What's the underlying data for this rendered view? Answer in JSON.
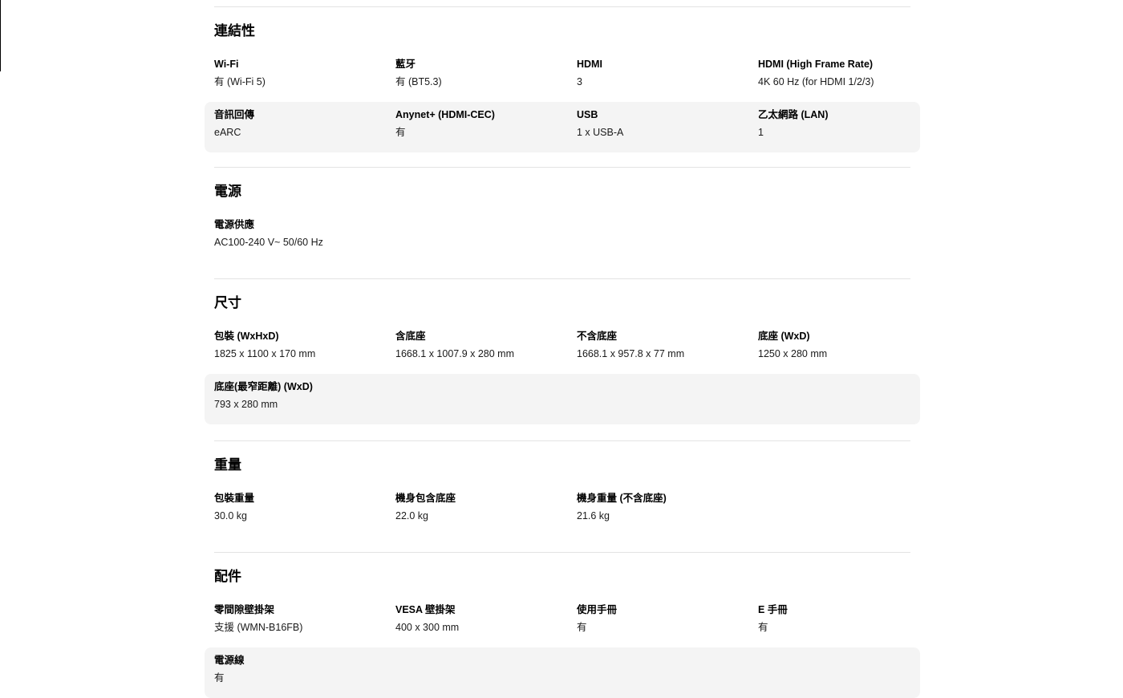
{
  "sections": [
    {
      "title": "連結性",
      "rows": [
        [
          {
            "label": "Wi-Fi",
            "value": "有 (Wi-Fi 5)"
          },
          {
            "label": "藍牙",
            "value": "有 (BT5.3)"
          },
          {
            "label": "HDMI",
            "value": "3"
          },
          {
            "label": "HDMI (High Frame Rate)",
            "value": "4K 60 Hz (for HDMI 1/2/3)"
          }
        ],
        [
          {
            "label": "音訊回傳",
            "value": "eARC"
          },
          {
            "label": "Anynet+ (HDMI-CEC)",
            "value": "有"
          },
          {
            "label": "USB",
            "value": "1 x USB-A"
          },
          {
            "label": "乙太網路 (LAN)",
            "value": "1"
          }
        ]
      ]
    },
    {
      "title": "電源",
      "rows": [
        [
          {
            "label": "電源供應",
            "value": "AC100-240 V~ 50/60 Hz"
          }
        ]
      ]
    },
    {
      "title": "尺寸",
      "rows": [
        [
          {
            "label": "包裝 (WxHxD)",
            "value": "1825 x 1100 x 170 mm"
          },
          {
            "label": "含底座",
            "value": "1668.1 x 1007.9 x 280 mm"
          },
          {
            "label": "不含底座",
            "value": "1668.1 x 957.8 x 77 mm"
          },
          {
            "label": "底座 (WxD)",
            "value": "1250 x 280 mm"
          }
        ],
        [
          {
            "label": "底座(最窄距離) (WxD)",
            "value": "793 x 280 mm"
          }
        ]
      ]
    },
    {
      "title": "重量",
      "rows": [
        [
          {
            "label": "包裝重量",
            "value": "30.0 kg"
          },
          {
            "label": "機身包含底座",
            "value": "22.0 kg"
          },
          {
            "label": "機身重量 (不含底座)",
            "value": "21.6 kg"
          }
        ]
      ]
    },
    {
      "title": "配件",
      "rows": [
        [
          {
            "label": "零間隙壁掛架",
            "value": "支援 (WMN-B16FB)"
          },
          {
            "label": "VESA 壁掛架",
            "value": "400 x 300 mm"
          },
          {
            "label": "使用手冊",
            "value": "有"
          },
          {
            "label": "E 手冊",
            "value": "有"
          }
        ],
        [
          {
            "label": "電源線",
            "value": "有"
          }
        ]
      ]
    }
  ],
  "colors": {
    "shaded_row": "#f4f4f4",
    "divider": "#e3e3e3"
  }
}
